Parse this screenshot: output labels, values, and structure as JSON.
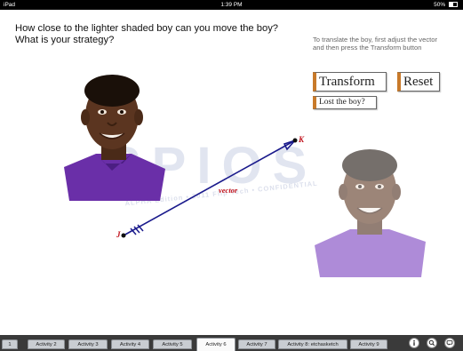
{
  "status_bar": {
    "carrier": "iPad",
    "time": "1:39 PM",
    "battery": "50%"
  },
  "question": "How close to the lighter shaded boy can you move the boy? What is your strategy?",
  "instructions": "To translate the boy, first adjust the vector and then press the Transform button",
  "buttons": {
    "transform": "Transform",
    "reset": "Reset",
    "lost": "Lost the boy?"
  },
  "watermark": {
    "logo": "SPIOS",
    "subtitle": "ALPHA Edition • 2011 Flip Tech • CONFIDENTIAL"
  },
  "vector": {
    "start_label": "J",
    "end_label": "K",
    "label": "vector"
  },
  "tabs": [
    {
      "label": "1"
    },
    {
      "label": "Activity 2"
    },
    {
      "label": "Activity 3"
    },
    {
      "label": "Activity 4"
    },
    {
      "label": "Activity 5"
    },
    {
      "label": "Activity 6",
      "active": true
    },
    {
      "label": "Activity 7"
    },
    {
      "label": "Activity 8: etchasketch"
    },
    {
      "label": "Activity 9"
    }
  ],
  "tab_icons": [
    "info-icon",
    "search-icon",
    "chat-icon"
  ]
}
